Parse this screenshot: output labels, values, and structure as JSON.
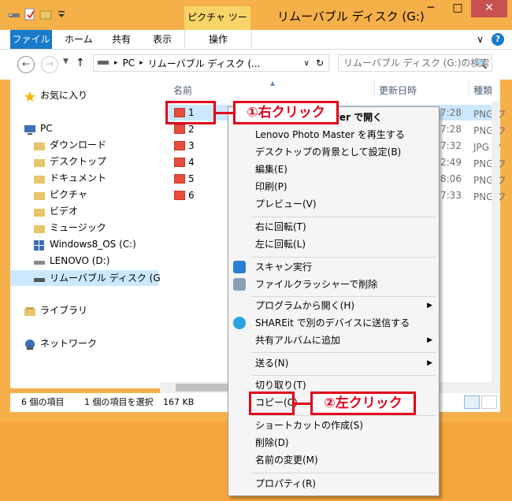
{
  "window": {
    "title": "リムーバブル ディスク (G:)",
    "context_tab": "ピクチャ ツール",
    "minimize": "─",
    "maximize": "□",
    "close": "✕"
  },
  "ribbon": {
    "tabs": [
      "ファイル",
      "ホーム",
      "共有",
      "表示",
      "操作"
    ],
    "help": "?",
    "expand": "∨"
  },
  "nav": {
    "back": "←",
    "forward": "→",
    "up": "↑",
    "address_parts": [
      "PC",
      "リムーバブル ディスク (..."
    ],
    "address_sep": "▸",
    "address_dropdown": "∨",
    "refresh": "↻",
    "search_placeholder": "リムーバブル ディスク (G:)の検索",
    "search_icon": "🔍"
  },
  "sidebar": {
    "items": [
      {
        "label": "お気に入り",
        "icon": "star-icon",
        "color": "#f4b400"
      },
      {
        "label": "PC",
        "icon": "computer-icon",
        "color": "#3d6eb4"
      },
      {
        "label": "ダウンロード",
        "icon": "folder-icon",
        "color": "#e8c46a"
      },
      {
        "label": "デスクトップ",
        "icon": "folder-icon",
        "color": "#e8c46a"
      },
      {
        "label": "ドキュメント",
        "icon": "folder-icon",
        "color": "#e8c46a"
      },
      {
        "label": "ピクチャ",
        "icon": "folder-icon",
        "color": "#e8c46a"
      },
      {
        "label": "ビデオ",
        "icon": "folder-icon",
        "color": "#e8c46a"
      },
      {
        "label": "ミュージック",
        "icon": "folder-icon",
        "color": "#e8c46a"
      },
      {
        "label": "Windows8_OS (C:)",
        "icon": "windows-drive-icon",
        "color": "#3d6eb4"
      },
      {
        "label": "LENOVO (D:)",
        "icon": "drive-icon",
        "color": "#8a8a8a"
      },
      {
        "label": "リムーバブル ディスク (G:)",
        "icon": "usb-drive-icon",
        "color": "#555555"
      },
      {
        "label": "ライブラリ",
        "icon": "library-icon",
        "color": "#e8c46a"
      },
      {
        "label": "ネットワーク",
        "icon": "network-icon",
        "color": "#3d6eb4"
      }
    ]
  },
  "file_list": {
    "columns": [
      "名前",
      "更新日時",
      "種類"
    ],
    "rows": [
      {
        "name": "1",
        "date": "7:28",
        "type": "PNG フ"
      },
      {
        "name": "2",
        "date": "7:28",
        "type": "PNG フ"
      },
      {
        "name": "3",
        "date": "7:32",
        "type": "JPG フ"
      },
      {
        "name": "4",
        "date": "2:49",
        "type": "PNG フ"
      },
      {
        "name": "5",
        "date": "8:06",
        "type": "PNG フ"
      },
      {
        "name": "6",
        "date": "7:33",
        "type": "PNG フ"
      }
    ]
  },
  "status": {
    "count": "6 個の項目",
    "selection": "1 個の項目を選択",
    "size": "167 KB"
  },
  "context_menu": {
    "items": [
      {
        "label": "ster で開く",
        "bold": true
      },
      {
        "label": "Lenovo Photo Master を再生する"
      },
      {
        "label": "デスクトップの背景として設定(B)"
      },
      {
        "label": "編集(E)"
      },
      {
        "label": "印刷(P)"
      },
      {
        "label": "プレビュー(V)"
      },
      {
        "label": "右に回転(T)"
      },
      {
        "label": "左に回転(L)"
      },
      {
        "label": "スキャン実行",
        "icon": "scan-icon"
      },
      {
        "label": "ファイルクラッシャーで削除",
        "icon": "shredder-icon"
      },
      {
        "label": "プログラムから開く(H)",
        "submenu": true
      },
      {
        "label": "SHAREit で別のデバイスに送信する",
        "icon": "shareit-icon"
      },
      {
        "label": "共有アルバムに追加",
        "submenu": true
      },
      {
        "label": "送る(N)",
        "submenu": true
      },
      {
        "label": "切り取り(T)"
      },
      {
        "label": "コピー(C)"
      },
      {
        "label": "ショートカットの作成(S)"
      },
      {
        "label": "削除(D)"
      },
      {
        "label": "名前の変更(M)"
      },
      {
        "label": "プロパティ(R)"
      }
    ],
    "submenu_arrow": "▶"
  },
  "annotations": {
    "right_click": "①右クリック",
    "left_click": "②左クリック",
    "color": "#e0001b"
  }
}
